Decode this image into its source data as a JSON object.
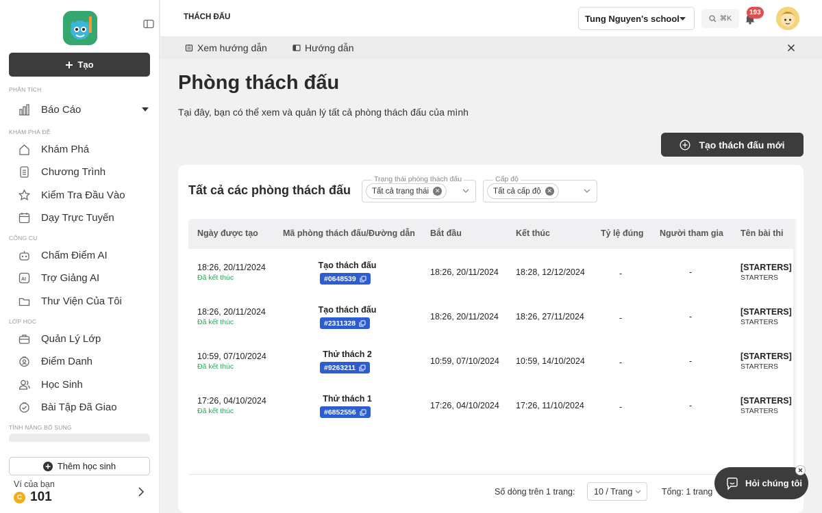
{
  "sidebar": {
    "create_label": "Tạo",
    "sections": {
      "analysis": "PHÂN TÍCH",
      "explore": "KHÁM PHÁ ĐỀ",
      "tools": "CÔNG CỤ",
      "class": "LỚP HỌC",
      "extra": "TÍNH NĂNG BỔ SUNG"
    },
    "items": [
      {
        "label": "Báo Cáo",
        "icon": "bar-chart-icon"
      },
      {
        "label": "Khám Phá",
        "icon": "home-icon"
      },
      {
        "label": "Chương Trình",
        "icon": "document-icon"
      },
      {
        "label": "Kiểm Tra Đầu Vào",
        "icon": "star-icon"
      },
      {
        "label": "Dạy Trực Tuyến",
        "icon": "calendar-icon"
      },
      {
        "label": "Chấm Điểm AI",
        "icon": "robot-icon"
      },
      {
        "label": "Trợ Giảng AI",
        "icon": "ai-icon"
      },
      {
        "label": "Thư Viện Của Tôi",
        "icon": "folder-icon"
      },
      {
        "label": "Quản Lý Lớp",
        "icon": "briefcase-icon"
      },
      {
        "label": "Điểm Danh",
        "icon": "attendance-icon"
      },
      {
        "label": "Học Sinh",
        "icon": "users-icon"
      },
      {
        "label": "Bài Tập Đã Giao",
        "icon": "assignment-icon"
      }
    ],
    "add_student_label": "Thêm học sinh",
    "wallet_label": "Ví của bạn",
    "wallet_value": "101",
    "coin_symbol": "C"
  },
  "topbar": {
    "title": "THÁCH ĐẤU",
    "school": "Tung Nguyen's school",
    "search_shortcut": "⌘K",
    "notification_count": "193"
  },
  "guidebar": {
    "view_guide": "Xem hướng dẫn",
    "guide": "Hướng dẫn"
  },
  "main": {
    "title": "Phòng thách đấu",
    "description": "Tại đây, bạn có thể xem và quản lý tất cả phòng thách đấu của mình",
    "new_button": "Tạo thách đấu mới",
    "card_title": "Tất cả các phòng thách đấu",
    "filters": {
      "status_label": "Trạng thái phòng thách đấu",
      "status_value": "Tất cả trạng thái",
      "level_label": "Cấp độ",
      "level_value": "Tất cả cấp độ"
    },
    "columns": [
      "Ngày được tạo",
      "Mã phòng thách đấu/Đường dẫn",
      "Bắt đầu",
      "Kết thúc",
      "Tỷ lệ đúng",
      "Người tham gia",
      "Tên bài thi"
    ],
    "rows": [
      {
        "created": "18:26, 20/11/2024",
        "status": "Đã kết thúc",
        "room": "Tạo thách đấu",
        "code": "#0648539",
        "start": "18:26, 20/11/2024",
        "end": "18:28, 12/12/2024",
        "rate": "-",
        "participants": "-",
        "quiz": "[STARTERS] BÀ",
        "level": "STARTERS"
      },
      {
        "created": "18:26, 20/11/2024",
        "status": "Đã kết thúc",
        "room": "Tạo thách đấu",
        "code": "#2311328",
        "start": "18:26, 20/11/2024",
        "end": "18:26, 27/11/2024",
        "rate": "-",
        "participants": "-",
        "quiz": "[STARTERS] BÀ",
        "level": "STARTERS"
      },
      {
        "created": "10:59, 07/10/2024",
        "status": "Đã kết thúc",
        "room": "Thử thách 2",
        "code": "#9263211",
        "start": "10:59, 07/10/2024",
        "end": "10:59, 14/10/2024",
        "rate": "-",
        "participants": "-",
        "quiz": "[STARTERS] BÀ",
        "level": "STARTERS"
      },
      {
        "created": "17:26, 04/10/2024",
        "status": "Đã kết thúc",
        "room": "Thử thách 1",
        "code": "#6852556",
        "start": "17:26, 04/10/2024",
        "end": "17:26, 11/10/2024",
        "rate": "-",
        "participants": "-",
        "quiz": "[STARTERS] BÀ",
        "level": "STARTERS"
      }
    ],
    "rows_per_page_label": "Số dòng trên 1 trang:",
    "page_size": "10 / Trang",
    "total": "Tổng: 1 trang"
  },
  "help": {
    "label": "Hỏi chúng tôi"
  },
  "colors": {
    "primary_dark": "#3c3c3c",
    "code_badge": "#2c5dd1",
    "status_green": "#27a555",
    "notification": "#e74c4c"
  }
}
